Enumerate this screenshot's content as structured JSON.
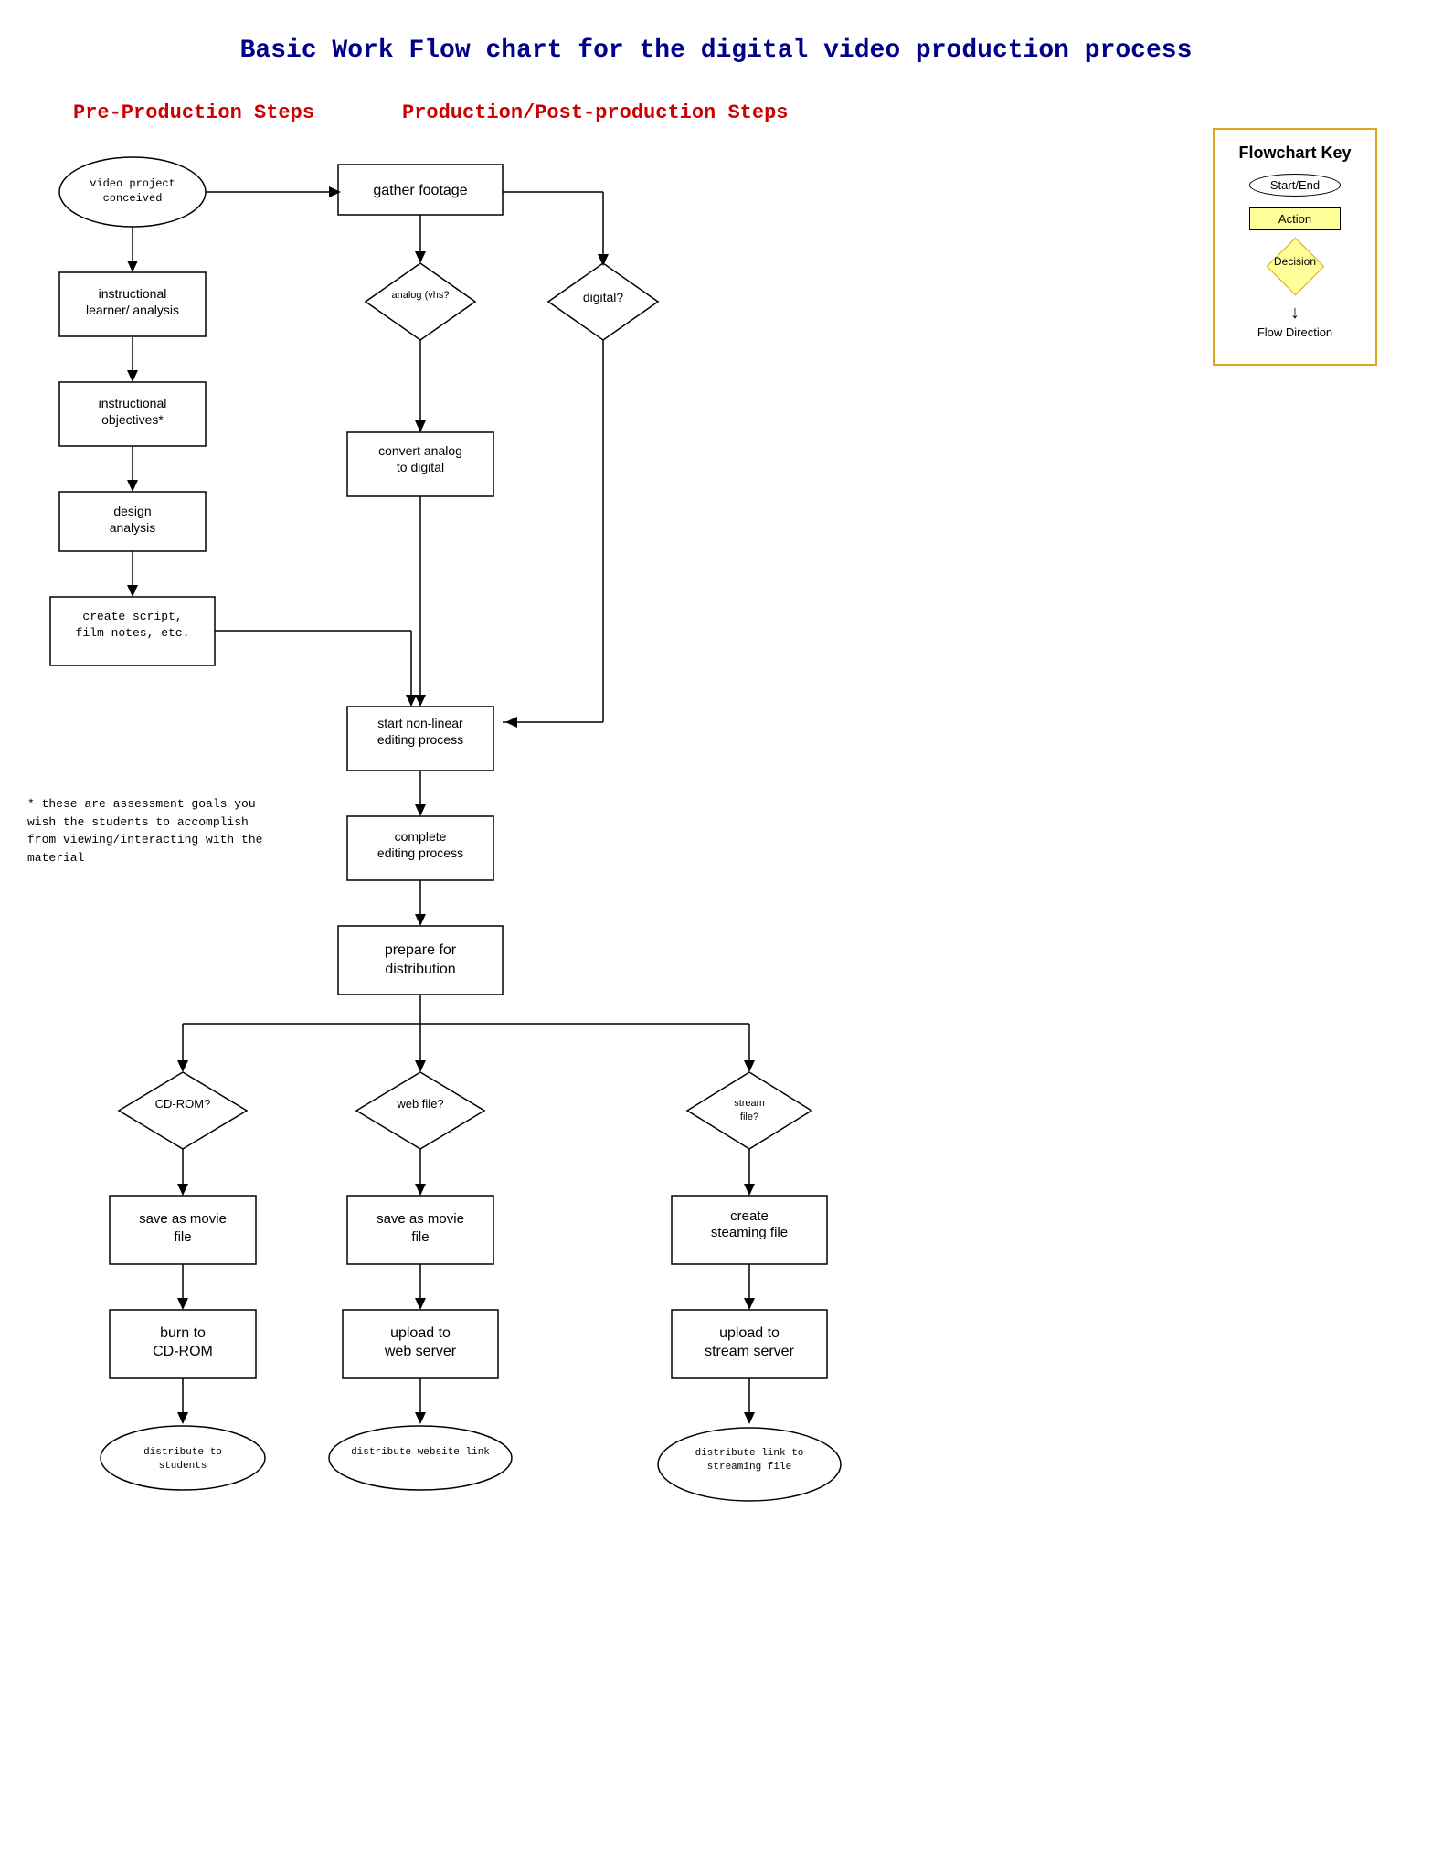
{
  "title": "Basic Work Flow chart for the digital video production process",
  "sections": {
    "pre_production": "Pre-Production Steps",
    "production": "Production/Post-production Steps"
  },
  "key": {
    "title": "Flowchart Key",
    "start_end": "Start/End",
    "action": "Action",
    "decision_label": "Decision",
    "flow_direction": "Flow Direction"
  },
  "note": "* these are assessment goals you wish the students to accomplish from viewing/interacting with the material",
  "nodes": {
    "video_conceived": "video project conceived",
    "instructional_learner": "instructional learner/ analysis",
    "instructional_obj": "instructional objectives*",
    "design_analysis": "design analysis",
    "create_script": "create script, film notes, etc.",
    "gather_footage": "gather footage",
    "analog_decision": "analog (vhs?",
    "digital_decision": "digital?",
    "convert_analog": "convert analog to digital",
    "start_nonlinear": "start non-linear editing process",
    "complete_editing": "complete editing process",
    "prepare_distribution": "prepare for distribution",
    "cdrom_decision": "CD-ROM?",
    "web_decision": "web file?",
    "stream_decision": "stream file?",
    "save_movie_cdrom": "save as movie file",
    "save_movie_web": "save as movie file",
    "create_streaming": "create steaming file",
    "burn_cdrom": "burn to CD-ROM",
    "upload_web": "upload to web server",
    "upload_stream": "upload to stream server",
    "distribute_students": "distribute to students",
    "distribute_website": "distribute website link",
    "distribute_streaming": "distribute link to streaming file"
  }
}
